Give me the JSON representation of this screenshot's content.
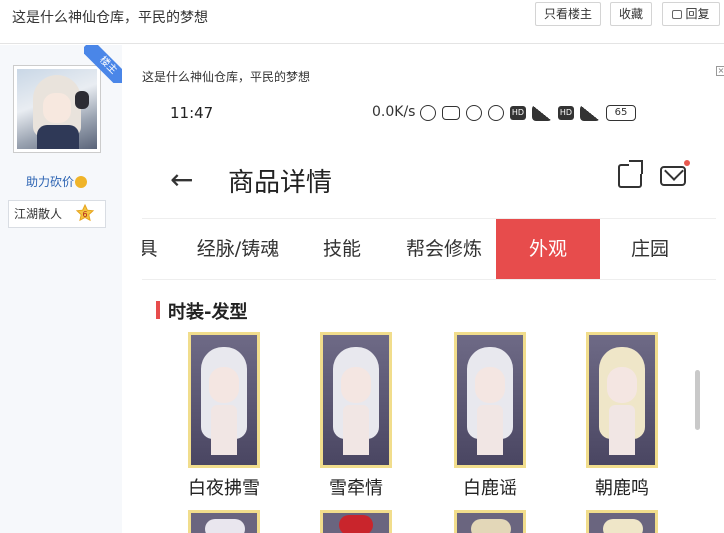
{
  "topbar": {
    "title": "这是什么神仙仓库，平民的梦想",
    "only_op_label": "只看楼主",
    "favorite_label": "收藏",
    "reply_label": "回复"
  },
  "user": {
    "badge_label": "楼主",
    "help_link": "助力砍价",
    "rank_title": "江湖散人",
    "rank_level": "6"
  },
  "post": {
    "title": "这是什么神仙仓库，平民的梦想"
  },
  "phone": {
    "time": "11:47",
    "speed": "0.0K/s",
    "battery": "65",
    "page_title": "商品详情",
    "tabs": [
      "具",
      "经脉/铸魂",
      "技能",
      "帮会修炼",
      "外观",
      "庄园"
    ],
    "active_tab_index": 4,
    "section_title": "时装-发型",
    "items": [
      {
        "name": "白夜拂雪"
      },
      {
        "name": "雪牵情"
      },
      {
        "name": "白鹿谣"
      },
      {
        "name": "朝鹿鸣"
      }
    ]
  },
  "colors": {
    "accent": "#e74c4c",
    "card_border": "#f1dd8c",
    "link": "#2d64b3",
    "badge": "#4a86e8"
  }
}
